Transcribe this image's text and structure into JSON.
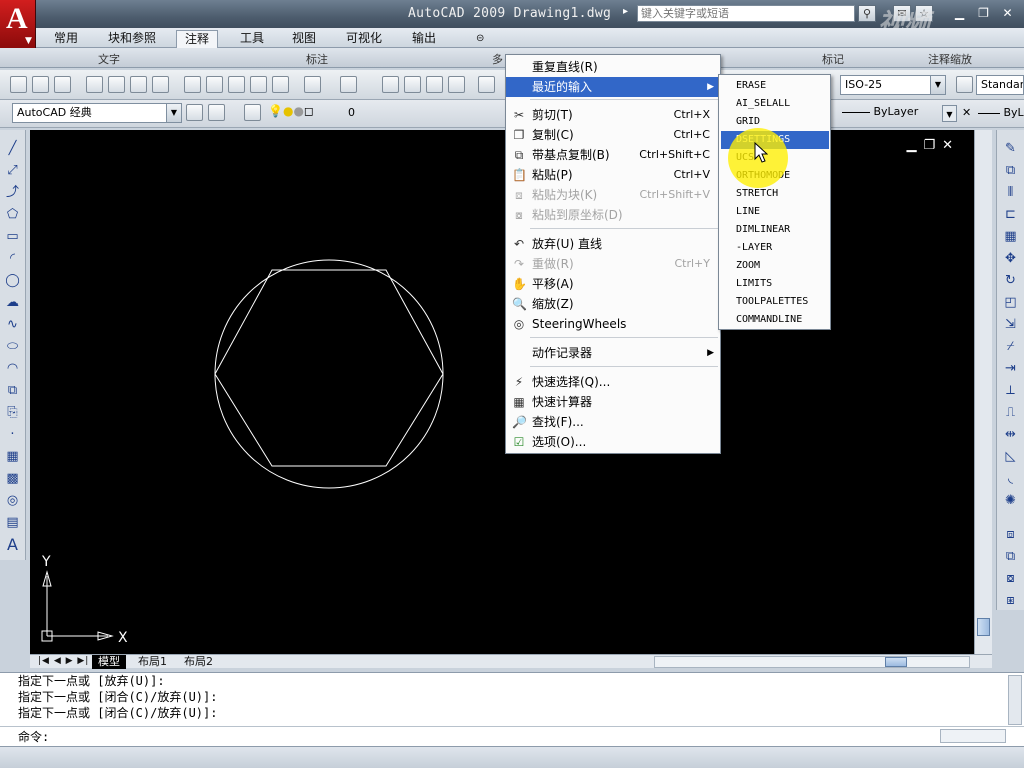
{
  "title": {
    "app_title": "AutoCAD 2009 Drawing1.dwg",
    "search_placeholder": "键入关键字或短语",
    "watermark": "视频"
  },
  "ribbon": {
    "tabs": [
      "常用",
      "块和参照",
      "注释",
      "工具",
      "视图",
      "可视化",
      "输出"
    ],
    "active_tab": "注释",
    "panels": [
      "文字",
      "标注",
      "多",
      "标记",
      "注释缩放"
    ]
  },
  "toolbar": {
    "workspace": "AutoCAD 经典",
    "layer": "0",
    "dimstyle": "ISO-25",
    "tablestyle": "Standar",
    "linetype": "ByLayer",
    "lineweight": "ByL"
  },
  "context_menu": {
    "items": [
      {
        "label": "重复直线(R)",
        "shortcut": "",
        "icon": "",
        "state": "normal"
      },
      {
        "label": "最近的输入",
        "shortcut": "",
        "icon": "",
        "state": "highlighted",
        "submenu": true
      },
      {
        "label": "剪切(T)",
        "shortcut": "Ctrl+X",
        "icon": "scissors-icon",
        "state": "normal"
      },
      {
        "label": "复制(C)",
        "shortcut": "Ctrl+C",
        "icon": "copy-icon",
        "state": "normal"
      },
      {
        "label": "带基点复制(B)",
        "shortcut": "Ctrl+Shift+C",
        "icon": "copy-base-icon",
        "state": "normal"
      },
      {
        "label": "粘贴(P)",
        "shortcut": "Ctrl+V",
        "icon": "paste-icon",
        "state": "normal"
      },
      {
        "label": "粘贴为块(K)",
        "shortcut": "Ctrl+Shift+V",
        "icon": "paste-block-icon",
        "state": "disabled"
      },
      {
        "label": "粘贴到原坐标(D)",
        "shortcut": "",
        "icon": "paste-orig-icon",
        "state": "disabled"
      },
      {
        "label": "放弃(U) 直线",
        "shortcut": "",
        "icon": "undo-icon",
        "state": "normal"
      },
      {
        "label": "重做(R)",
        "shortcut": "Ctrl+Y",
        "icon": "redo-icon",
        "state": "disabled"
      },
      {
        "label": "平移(A)",
        "shortcut": "",
        "icon": "pan-icon",
        "state": "normal"
      },
      {
        "label": "缩放(Z)",
        "shortcut": "",
        "icon": "zoom-icon",
        "state": "normal"
      },
      {
        "label": "SteeringWheels",
        "shortcut": "",
        "icon": "steeringwheel-icon",
        "state": "normal"
      },
      {
        "label": "动作记录器",
        "shortcut": "",
        "icon": "",
        "state": "normal",
        "submenu": true
      },
      {
        "label": "快速选择(Q)...",
        "shortcut": "",
        "icon": "quickselect-icon",
        "state": "normal"
      },
      {
        "label": "快速计算器",
        "shortcut": "",
        "icon": "calculator-icon",
        "state": "normal"
      },
      {
        "label": "查找(F)...",
        "shortcut": "",
        "icon": "find-icon",
        "state": "normal"
      },
      {
        "label": "选项(O)...",
        "shortcut": "",
        "icon": "options-icon",
        "state": "normal"
      }
    ]
  },
  "recent_input": {
    "items": [
      "ERASE",
      "AI_SELALL",
      "GRID",
      "DSETTINGS",
      "UCS",
      "ORTHOMODE",
      "STRETCH",
      "LINE",
      "DIMLINEAR",
      "-LAYER",
      "ZOOM",
      "LIMITS",
      "TOOLPALETTES",
      "COMMANDLINE"
    ],
    "highlighted": "DSETTINGS"
  },
  "drawing": {
    "ucs_x": "X",
    "ucs_y": "Y",
    "line_color": "#ffffff",
    "background": "#000000"
  },
  "layout_tabs": [
    "模型",
    "布局1",
    "布局2"
  ],
  "command": {
    "history": [
      "指定下一点或 [放弃(U)]:",
      "指定下一点或 [闭合(C)/放弃(U)]:",
      "指定下一点或 [闭合(C)/放弃(U)]:"
    ],
    "prompt": "命令:"
  }
}
